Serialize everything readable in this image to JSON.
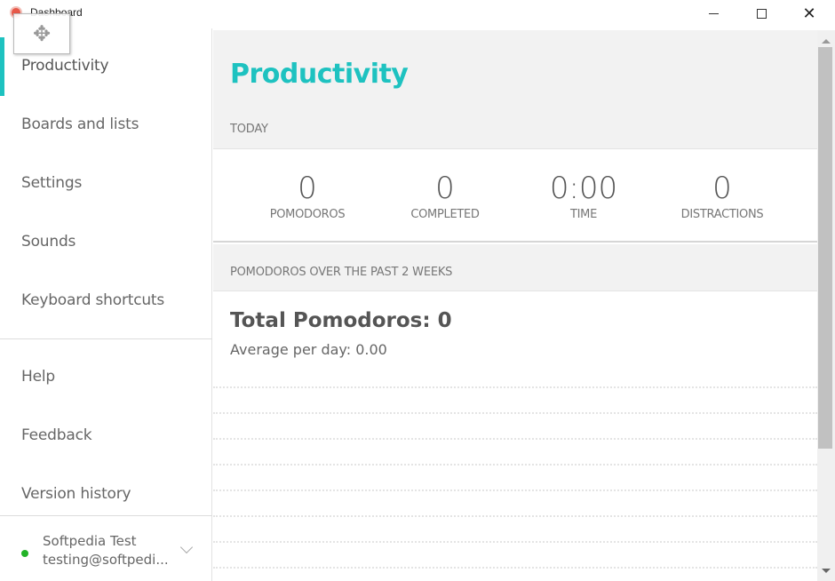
{
  "window": {
    "title": "Dashboard",
    "icons": {
      "app": "tomato-app-icon",
      "move_cursor": "move-cursor-icon",
      "minimize": "minimize-icon",
      "maximize": "maximize-icon",
      "close": "close-icon"
    },
    "close_glyph": "✕"
  },
  "sidebar": {
    "active_color": "#1ec2c0",
    "primary_items": [
      {
        "label": "Productivity",
        "active": true
      },
      {
        "label": "Boards and lists",
        "active": false
      },
      {
        "label": "Settings",
        "active": false
      },
      {
        "label": "Sounds",
        "active": false
      },
      {
        "label": "Keyboard shortcuts",
        "active": false
      }
    ],
    "secondary_items": [
      {
        "label": "Help"
      },
      {
        "label": "Feedback"
      },
      {
        "label": "Version history"
      }
    ],
    "user": {
      "name": "Softpedia Test",
      "email": "testing@softpedi...",
      "status_color": "#22b327"
    }
  },
  "main": {
    "title": "Productivity",
    "title_color": "#1ec2c0",
    "today": {
      "label": "TODAY",
      "stats": [
        {
          "value": "0",
          "label": "POMODOROS"
        },
        {
          "value": "0",
          "label": "COMPLETED"
        },
        {
          "value": "0:00",
          "label": "TIME"
        },
        {
          "value": "0",
          "label": "DISTRACTIONS"
        }
      ]
    },
    "weeks": {
      "label": "POMODOROS OVER THE PAST 2 WEEKS",
      "total": "Total Pomodoros: 0",
      "average": "Average per day: 0.00"
    }
  }
}
